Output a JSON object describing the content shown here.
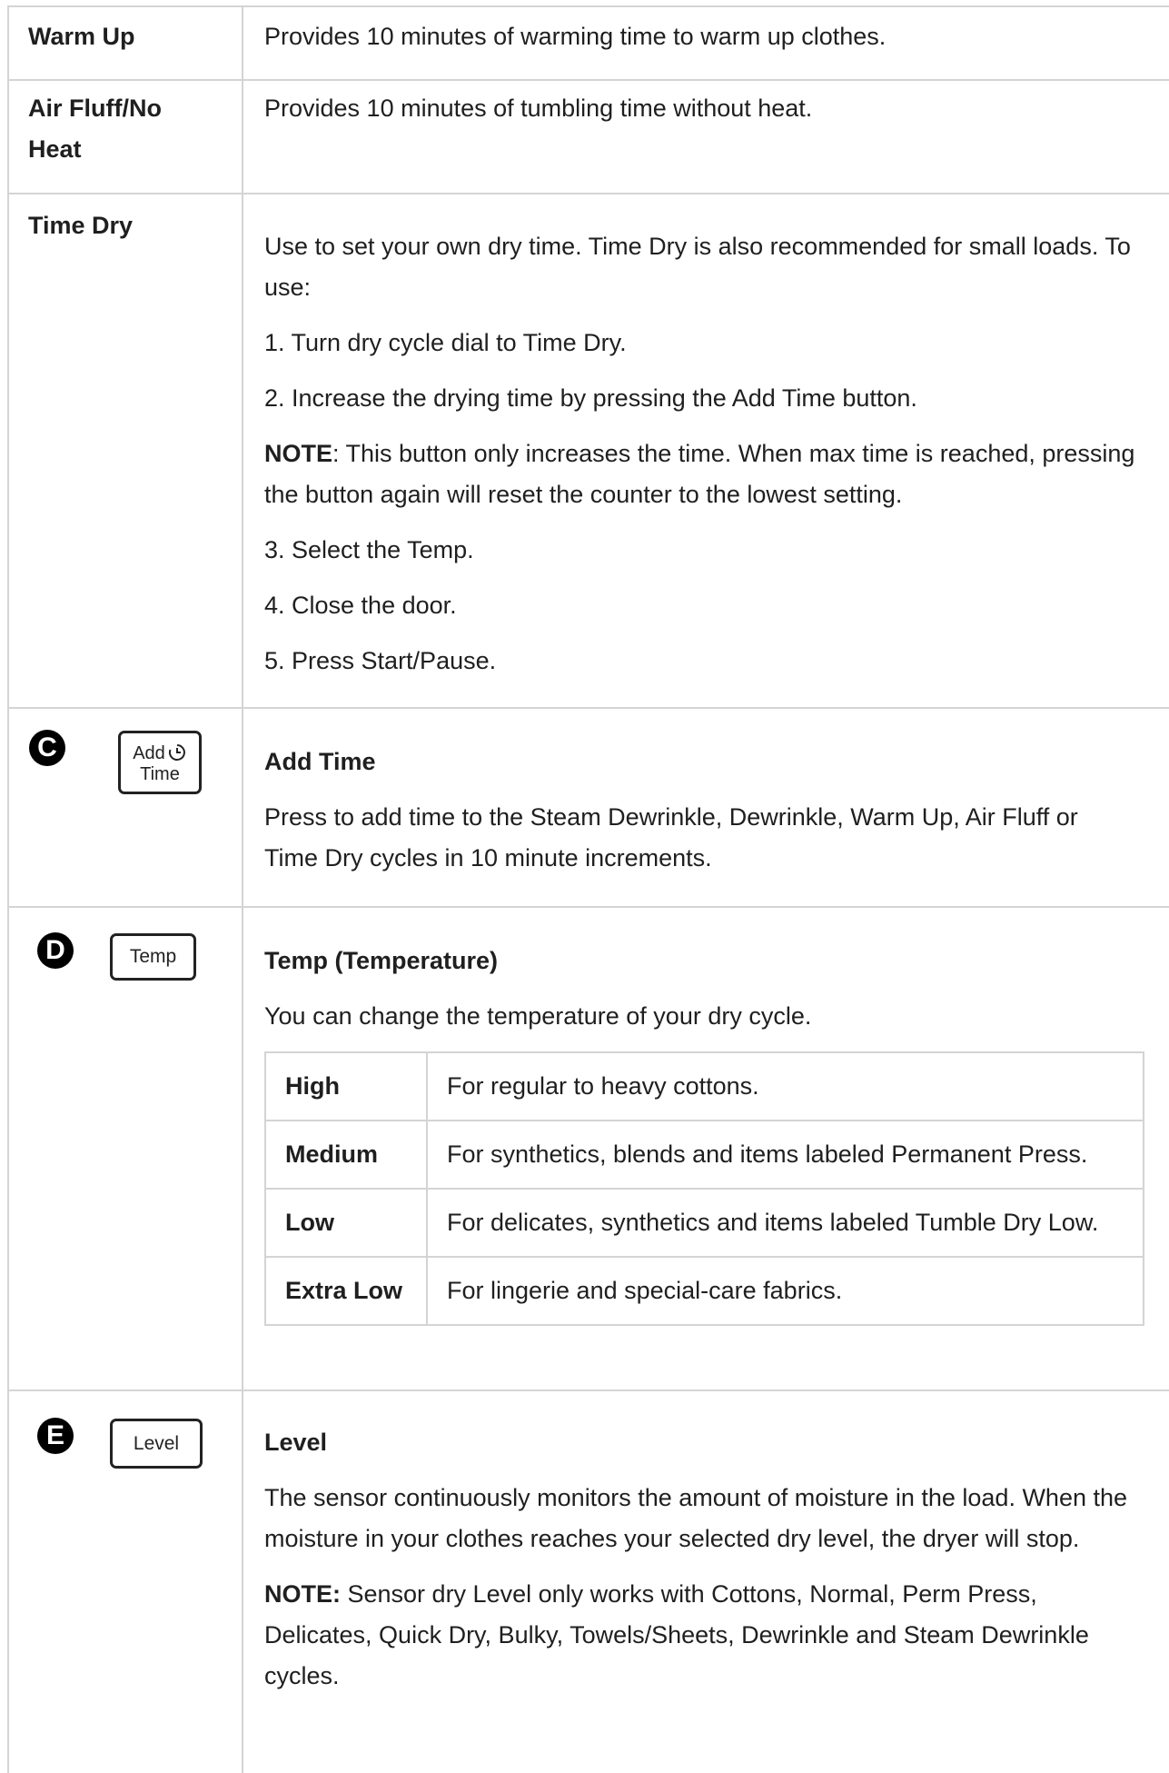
{
  "rows": {
    "warm_up": {
      "label": "Warm Up",
      "text": "Provides 10 minutes of warming time to warm up clothes."
    },
    "air_fluff": {
      "label": "Air Fluff/No Heat",
      "text": "Provides 10 minutes of tumbling time without heat."
    },
    "time_dry": {
      "label": "Time Dry",
      "intro": "Use to set your own dry time. Time Dry is also recommended for small loads. To use:",
      "step1": "1. Turn dry cycle dial to Time Dry.",
      "step2": "2. Increase the drying time by pressing the Add Time button.",
      "note_label": "NOTE",
      "note_text": ": This button only increases the time. When max time is reached, pressing the button again will reset the counter to the lowest setting.",
      "step3": "3. Select the Temp.",
      "step4": "4. Close the door.",
      "step5": "5. Press Start/Pause."
    },
    "add_time": {
      "marker": "C",
      "button_line1": "Add",
      "button_line2": "Time",
      "icon": "clock-icon",
      "title": "Add Time",
      "text": "Press to add time to the Steam Dewrinkle, Dewrinkle, Warm Up, Air Fluff or Time Dry cycles in 10 minute increments."
    },
    "temp": {
      "marker": "D",
      "button_label": "Temp",
      "title": "Temp (Temperature)",
      "text": "You can change the temperature of your dry cycle.",
      "settings": [
        {
          "name": "High",
          "desc": "For regular to heavy cottons."
        },
        {
          "name": "Medium",
          "desc": "For synthetics, blends and items labeled Permanent Press."
        },
        {
          "name": "Low",
          "desc": "For delicates, synthetics and items labeled Tumble Dry Low."
        },
        {
          "name": "Extra Low",
          "desc": "For lingerie and special-care fabrics."
        }
      ]
    },
    "level": {
      "marker": "E",
      "button_label": "Level",
      "title": "Level",
      "text": "The sensor continuously monitors the amount of moisture in the load. When the moisture in your clothes reaches your selected dry level, the dryer will stop.",
      "note_label": "NOTE:",
      "note_text": " Sensor dry Level only works with Cottons, Normal, Perm Press, Delicates, Quick Dry, Bulky, Towels/Sheets, Dewrinkle and Steam Dewrinkle cycles."
    }
  }
}
